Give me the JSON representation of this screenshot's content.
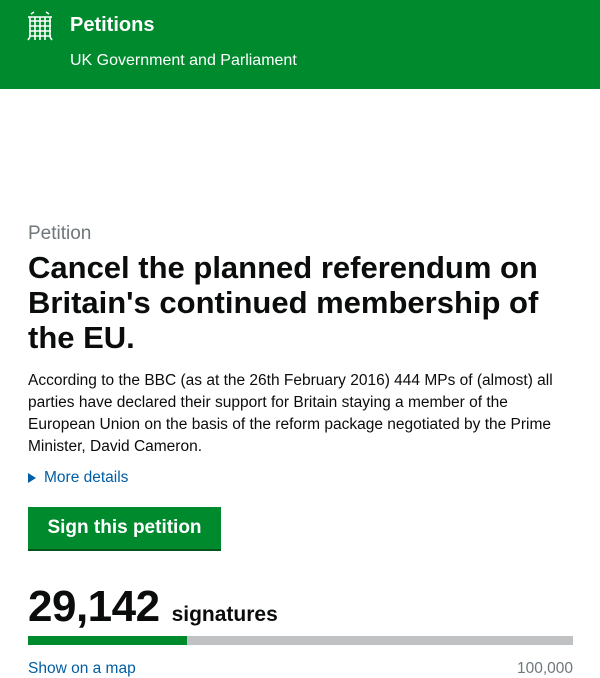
{
  "header": {
    "title": "Petitions",
    "subtitle": "UK Government and Parliament",
    "logo_icon": "portcullis-icon",
    "background": "#008a2e"
  },
  "petition": {
    "kicker": "Petition",
    "title": "Cancel the planned referendum on Britain's continued membership of the EU.",
    "description": "According to the BBC (as at the 26th February 2016) 444 MPs of (almost) all parties have declared their support for Britain staying a member of the European Union on the basis of the reform package negotiated by the Prime Minister, David Cameron.",
    "more_details_label": "More details",
    "sign_button_label": "Sign this petition"
  },
  "signatures": {
    "count": "29,142",
    "label": "signatures",
    "count_value": 29142,
    "target_value": 100000,
    "target_label": "100,000",
    "map_link_label": "Show on a map"
  },
  "colors": {
    "brand_green": "#008a2e",
    "link_blue": "#005ea5",
    "muted_grey": "#6f777b",
    "progress_track": "#bfc1c3"
  }
}
